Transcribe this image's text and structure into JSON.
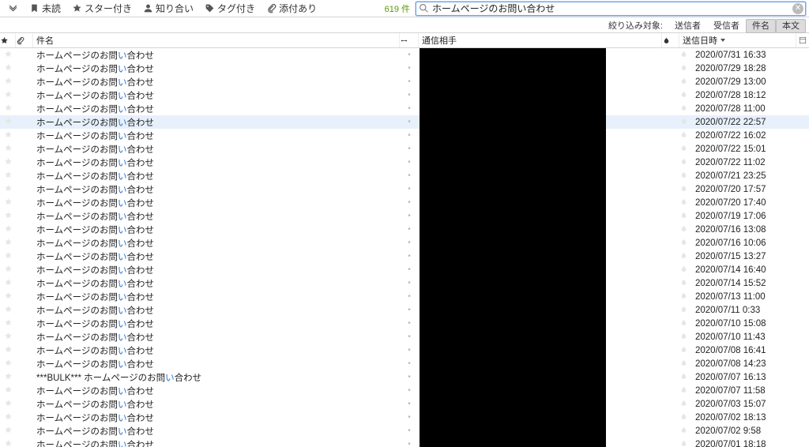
{
  "toolbar": {
    "filter_icon": "filter-icon",
    "unread": {
      "icon": "bookmark-icon",
      "label": "未読"
    },
    "starred": {
      "icon": "star-icon",
      "label": "スター付き"
    },
    "contacts": {
      "icon": "person-icon",
      "label": "知り合い"
    },
    "tagged": {
      "icon": "tag-icon",
      "label": "タグ付き"
    },
    "attach": {
      "icon": "paperclip-icon",
      "label": "添付あり"
    },
    "count_text": "619 件"
  },
  "search": {
    "value": "ホームページのお問い合わせ",
    "clear_title": "clear"
  },
  "filterbar": {
    "label": "絞り込み対象:",
    "options": [
      {
        "key": "sender",
        "label": "送信者",
        "active": false
      },
      {
        "key": "recipient",
        "label": "受信者",
        "active": false
      },
      {
        "key": "subject",
        "label": "件名",
        "active": true
      },
      {
        "key": "body",
        "label": "本文",
        "active": true
      }
    ]
  },
  "columns": {
    "star": "star",
    "clip": "attachment",
    "subject": "件名",
    "thread": "thread",
    "correspondent": "通信相手",
    "flag": "flag",
    "date": "送信日時",
    "menu": "menu"
  },
  "highlight_pattern": "い",
  "rows": [
    {
      "subject": "ホームページのお問い合わせ",
      "date": "2020/07/31 16:33",
      "selected": false
    },
    {
      "subject": "ホームページのお問い合わせ",
      "date": "2020/07/29 18:28",
      "selected": false
    },
    {
      "subject": "ホームページのお問い合わせ",
      "date": "2020/07/29 13:00",
      "selected": false
    },
    {
      "subject": "ホームページのお問い合わせ",
      "date": "2020/07/28 18:12",
      "selected": false
    },
    {
      "subject": "ホームページのお問い合わせ",
      "date": "2020/07/28 11:00",
      "selected": false
    },
    {
      "subject": "ホームページのお問い合わせ",
      "date": "2020/07/22 22:57",
      "selected": true
    },
    {
      "subject": "ホームページのお問い合わせ",
      "date": "2020/07/22 16:02",
      "selected": false
    },
    {
      "subject": "ホームページのお問い合わせ",
      "date": "2020/07/22 15:01",
      "selected": false
    },
    {
      "subject": "ホームページのお問い合わせ",
      "date": "2020/07/22 11:02",
      "selected": false
    },
    {
      "subject": "ホームページのお問い合わせ",
      "date": "2020/07/21 23:25",
      "selected": false
    },
    {
      "subject": "ホームページのお問い合わせ",
      "date": "2020/07/20 17:57",
      "selected": false
    },
    {
      "subject": "ホームページのお問い合わせ",
      "date": "2020/07/20 17:40",
      "selected": false
    },
    {
      "subject": "ホームページのお問い合わせ",
      "date": "2020/07/19 17:06",
      "selected": false
    },
    {
      "subject": "ホームページのお問い合わせ",
      "date": "2020/07/16 13:08",
      "selected": false
    },
    {
      "subject": "ホームページのお問い合わせ",
      "date": "2020/07/16 10:06",
      "selected": false
    },
    {
      "subject": "ホームページのお問い合わせ",
      "date": "2020/07/15 13:27",
      "selected": false
    },
    {
      "subject": "ホームページのお問い合わせ",
      "date": "2020/07/14 16:40",
      "selected": false
    },
    {
      "subject": "ホームページのお問い合わせ",
      "date": "2020/07/14 15:52",
      "selected": false
    },
    {
      "subject": "ホームページのお問い合わせ",
      "date": "2020/07/13 11:00",
      "selected": false
    },
    {
      "subject": "ホームページのお問い合わせ",
      "date": "2020/07/11 0:33",
      "selected": false
    },
    {
      "subject": "ホームページのお問い合わせ",
      "date": "2020/07/10 15:08",
      "selected": false
    },
    {
      "subject": "ホームページのお問い合わせ",
      "date": "2020/07/10 11:43",
      "selected": false
    },
    {
      "subject": "ホームページのお問い合わせ",
      "date": "2020/07/08 16:41",
      "selected": false
    },
    {
      "subject": "ホームページのお問い合わせ",
      "date": "2020/07/08 14:23",
      "selected": false
    },
    {
      "subject": "***BULK*** ホームページのお問い合わせ",
      "date": "2020/07/07 16:13",
      "selected": false
    },
    {
      "subject": "ホームページのお問い合わせ",
      "date": "2020/07/07 11:58",
      "selected": false
    },
    {
      "subject": "ホームページのお問い合わせ",
      "date": "2020/07/03 15:07",
      "selected": false
    },
    {
      "subject": "ホームページのお問い合わせ",
      "date": "2020/07/02 18:13",
      "selected": false
    },
    {
      "subject": "ホームページのお問い合わせ",
      "date": "2020/07/02 9:58",
      "selected": false
    },
    {
      "subject": "ホームページのお問い合わせ",
      "date": "2020/07/01 18:18",
      "selected": false
    }
  ]
}
